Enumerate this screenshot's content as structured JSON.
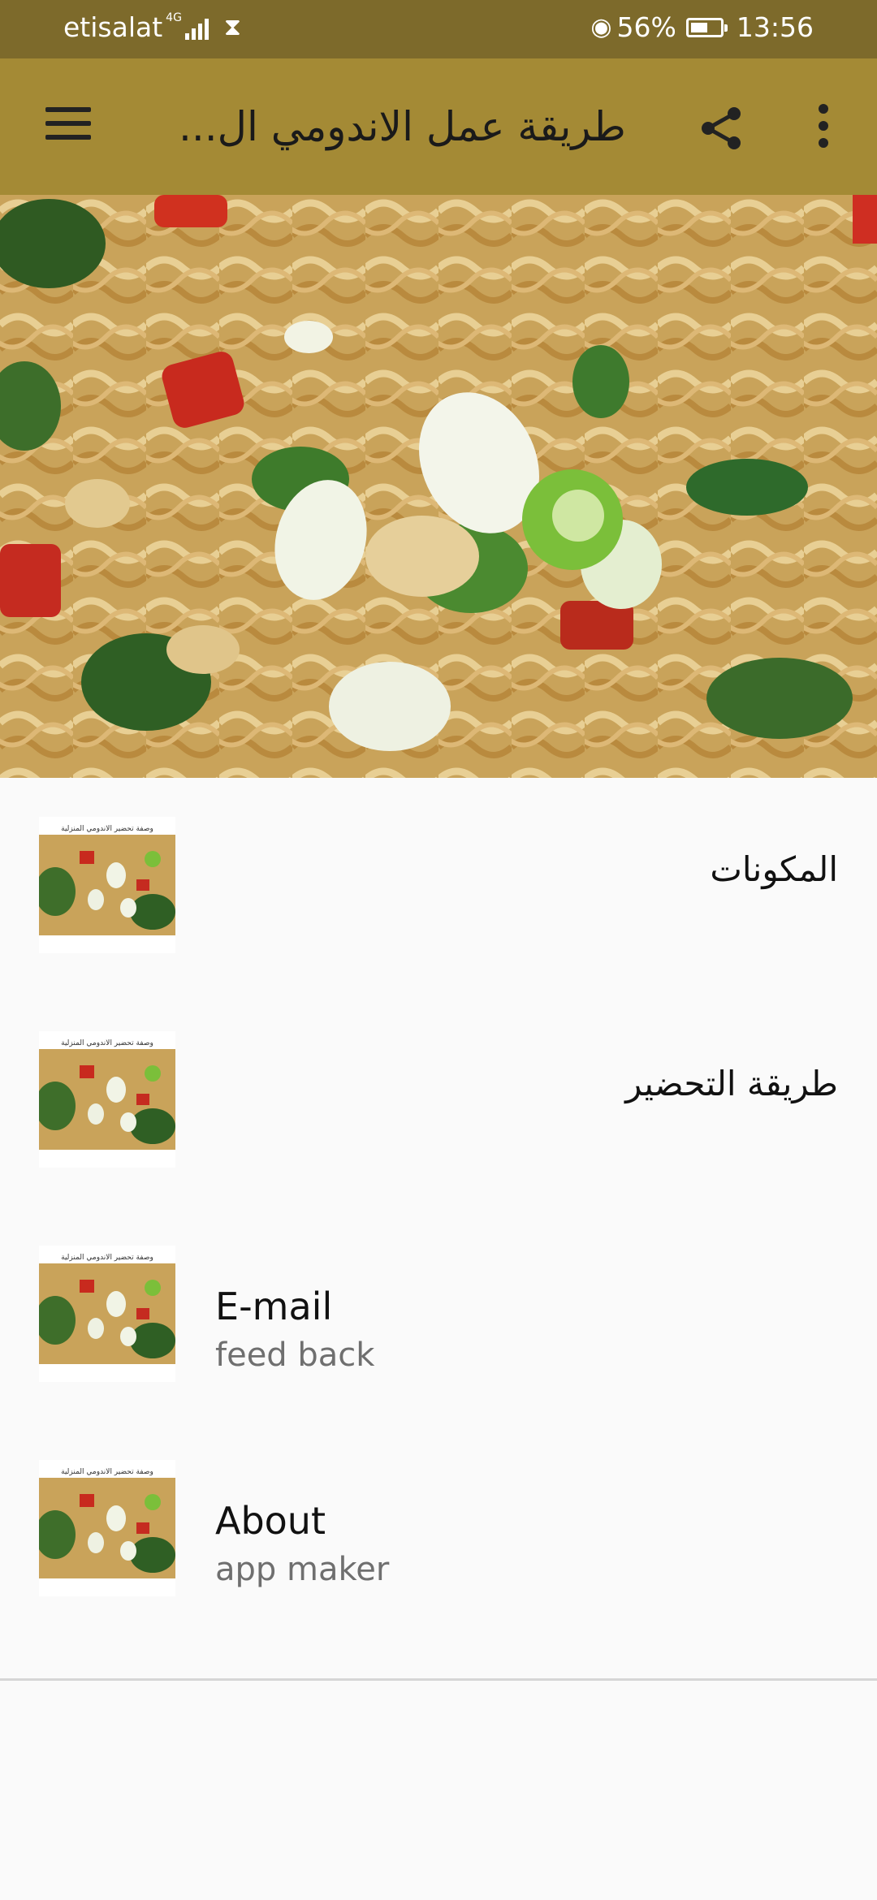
{
  "status_bar": {
    "carrier": "etisalat",
    "network": "4G",
    "battery": "56%",
    "time": "13:56"
  },
  "app_bar": {
    "title": "طريقة عمل الاندومي ال...",
    "menu_icon": "hamburger-menu-icon",
    "share_icon": "share-icon",
    "more_icon": "more-vert-icon",
    "color": "#a48a35"
  },
  "list": {
    "thumb_caption": "وصفة تحضير الاندومي المنزلية",
    "items": [
      {
        "title": "المكونات"
      },
      {
        "title": "طريقة التحضير"
      },
      {
        "title": "E-mail",
        "subtitle": "feed back"
      },
      {
        "title": "About",
        "subtitle": "app maker"
      }
    ]
  }
}
